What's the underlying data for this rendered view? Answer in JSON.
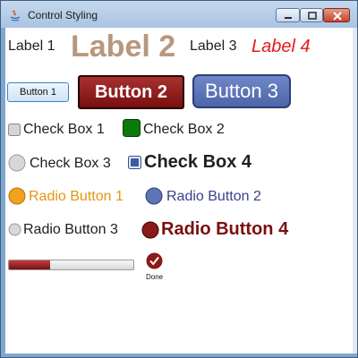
{
  "window": {
    "title": "Control Styling"
  },
  "labels": {
    "label1": "Label 1",
    "label2": "Label 2",
    "label3": "Label 3",
    "label4": "Label 4"
  },
  "buttons": {
    "button1": "Button 1",
    "button2": "Button 2",
    "button3": "Button 3"
  },
  "checkboxes": [
    {
      "label": "Check Box 1",
      "checked": false
    },
    {
      "label": "Check Box 2",
      "checked": true
    },
    {
      "label": "Check Box 3",
      "checked": false
    },
    {
      "label": "Check Box 4",
      "checked": true
    }
  ],
  "radios": [
    {
      "label": "Radio Button 1",
      "selected": true
    },
    {
      "label": "Radio Button 2",
      "selected": true
    },
    {
      "label": "Radio Button 3",
      "selected": false
    },
    {
      "label": "Radio Button 4",
      "selected": true
    }
  ],
  "progress": {
    "value": 0.33,
    "done_label": "Done"
  },
  "colors": {
    "label2": "#b7987f",
    "label4": "#e41b1b",
    "button2_bg": "#8b1a1a",
    "button3_bg": "#5c74b8",
    "radio1": "#e69514",
    "radio2": "#3a3f8c",
    "radio4": "#7a0f0f",
    "progress_fill": "#a02020"
  }
}
